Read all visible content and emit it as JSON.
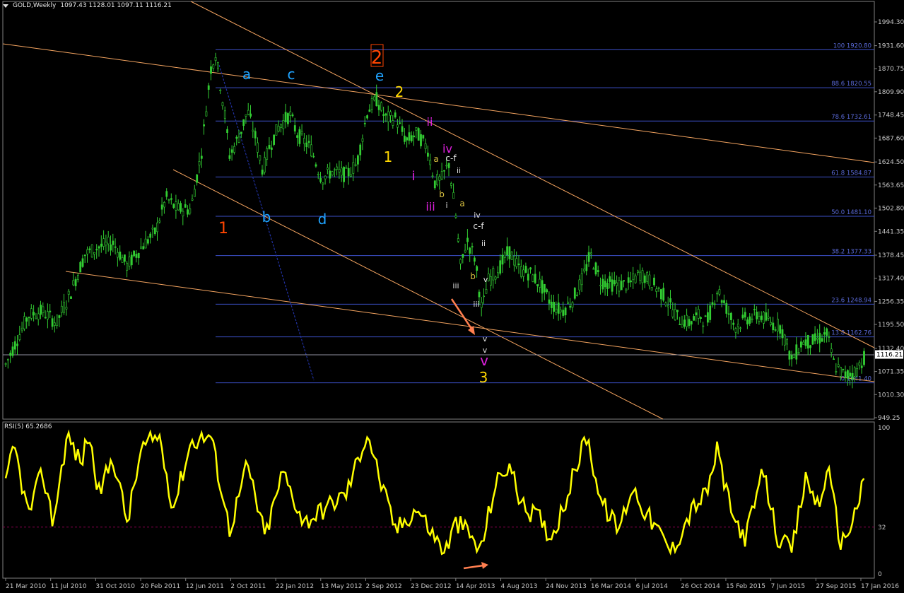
{
  "window": {
    "symbol_label": "GOLD,Weekly",
    "ohlc": "1097.43 1128.01 1097.11 1116.21"
  },
  "rsi": {
    "label": "RSI(5) 65.2686",
    "levels": [
      "100",
      "32",
      "0"
    ],
    "level_line_value": 32
  },
  "price_axis": {
    "ticks": [
      "1994.30",
      "1931.60",
      "1870.75",
      "1809.90",
      "1748.45",
      "1687.60",
      "1624.50",
      "1563.65",
      "1502.80",
      "1441.35",
      "1378.45",
      "1317.40",
      "1256.35",
      "1195.50",
      "1132.40",
      "1071.35",
      "1010.30",
      "949.25"
    ],
    "current_price": "1116.21"
  },
  "time_axis": {
    "labels": [
      "21 Mar 2010",
      "11 Jul 2010",
      "31 Oct 2010",
      "20 Feb 2011",
      "12 Jun 2011",
      "2 Oct 2011",
      "22 Jan 2012",
      "13 May 2012",
      "2 Sep 2012",
      "23 Dec 2012",
      "14 Apr 2013",
      "4 Aug 2013",
      "24 Nov 2013",
      "16 Mar 2014",
      "6 Jul 2014",
      "26 Oct 2014",
      "15 Feb 2015",
      "7 Jun 2015",
      "27 Sep 2015",
      "17 Jan 2016"
    ]
  },
  "fibonacci": [
    {
      "label": "100 1920.80",
      "price": 1920.8
    },
    {
      "label": "88.6 1820.55",
      "price": 1820.55
    },
    {
      "label": "78.6 1732.61",
      "price": 1732.61
    },
    {
      "label": "61.8 1584.87",
      "price": 1584.87
    },
    {
      "label": "50.0 1481.10",
      "price": 1481.1
    },
    {
      "label": "38.2 1377.33",
      "price": 1377.33
    },
    {
      "label": "23.6 1248.94",
      "price": 1248.94
    },
    {
      "label": "13.8 1162.76",
      "price": 1162.76
    },
    {
      "label": "0 1041.40",
      "price": 1041.4
    }
  ],
  "wave_labels": [
    {
      "text": "1",
      "color": "#ff4500",
      "size": 22
    },
    {
      "text": "2",
      "color": "#ff4500",
      "size": 26
    },
    {
      "text": "a",
      "color": "#1fa3ff",
      "size": 20
    },
    {
      "text": "b",
      "color": "#1fa3ff",
      "size": 20
    },
    {
      "text": "c",
      "color": "#1fa3ff",
      "size": 20
    },
    {
      "text": "d",
      "color": "#1fa3ff",
      "size": 20
    },
    {
      "text": "e",
      "color": "#1fa3ff",
      "size": 20
    },
    {
      "text": "2",
      "color": "#ffd700",
      "size": 20
    },
    {
      "text": "1",
      "color": "#ffd700",
      "size": 20
    },
    {
      "text": "3",
      "color": "#ffd700",
      "size": 20
    },
    {
      "text": "i",
      "color": "#e020e0",
      "size": 18
    },
    {
      "text": "ii",
      "color": "#e020e0",
      "size": 16
    },
    {
      "text": "iii",
      "color": "#e020e0",
      "size": 16
    },
    {
      "text": "iv",
      "color": "#e020e0",
      "size": 16
    },
    {
      "text": "v",
      "color": "#e020e0",
      "size": 20
    },
    {
      "text": "a",
      "color": "#d8c040",
      "size": 12
    },
    {
      "text": "c-f",
      "color": "#e0e0e0",
      "size": 12
    },
    {
      "text": "ii",
      "color": "#e0e0e0",
      "size": 11
    },
    {
      "text": "b",
      "color": "#d8c040",
      "size": 12
    },
    {
      "text": "i",
      "color": "#e0e0e0",
      "size": 11
    },
    {
      "text": "a",
      "color": "#d8c040",
      "size": 12
    },
    {
      "text": "iv",
      "color": "#e0e0e0",
      "size": 11
    },
    {
      "text": "c-f",
      "color": "#e0e0e0",
      "size": 12
    },
    {
      "text": "ii",
      "color": "#e0e0e0",
      "size": 11
    },
    {
      "text": "iii",
      "color": "#e0e0e0",
      "size": 11
    },
    {
      "text": "b",
      "color": "#d8c040",
      "size": 12
    },
    {
      "text": "v",
      "color": "#e0e0e0",
      "size": 11
    },
    {
      "text": "iii",
      "color": "#e0e0e0",
      "size": 11
    },
    {
      "text": "v",
      "color": "#e0e0e0",
      "size": 11
    },
    {
      "text": "v",
      "color": "#e0e0e0",
      "size": 11
    }
  ],
  "colors": {
    "candle": "#32cd32",
    "fib_line": "#3c50c8",
    "fib_text": "#5a6ad8",
    "trend_line": "#f4a460",
    "rsi_line": "#ffff00",
    "rsi_level": "#8b0050",
    "arrow": "#ff7f50",
    "background": "#000000",
    "axis_text": "#c8c8c8"
  }
}
